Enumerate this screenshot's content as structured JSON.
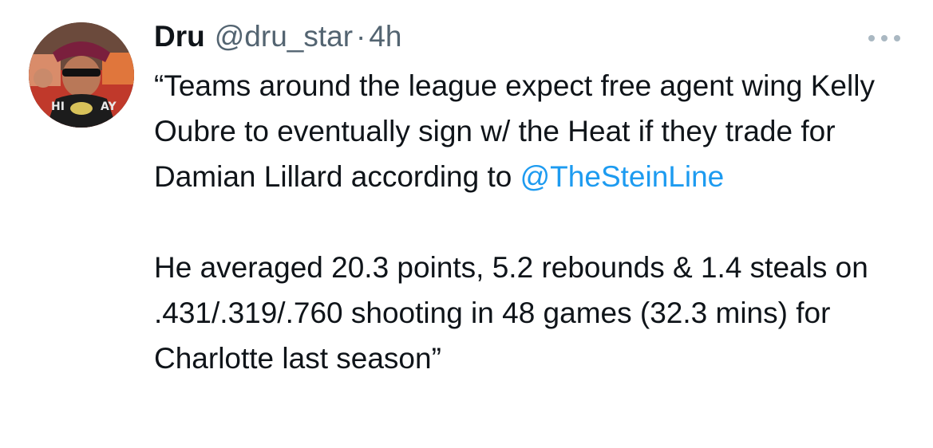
{
  "tweet": {
    "author": {
      "display_name": "Dru",
      "handle": "@dru_star"
    },
    "separator": "·",
    "timestamp": "4h",
    "more_icon": "ellipsis-icon",
    "body": {
      "paragraph1_text": "“Teams around the league expect free agent wing Kelly Oubre to eventually sign w/ the Heat if they trade for Damian Lillard according to ",
      "paragraph1_mention": "@TheSteinLine",
      "paragraph2_text": "He averaged 20.3 points, 5.2 rebounds & 1.4 steals on .431/.319/.760 shooting in 48 games (32.3 mins) for Charlotte last season”"
    }
  },
  "colors": {
    "text_primary": "#0f1419",
    "text_secondary": "#536471",
    "link": "#1d9bf0",
    "background": "#ffffff"
  }
}
